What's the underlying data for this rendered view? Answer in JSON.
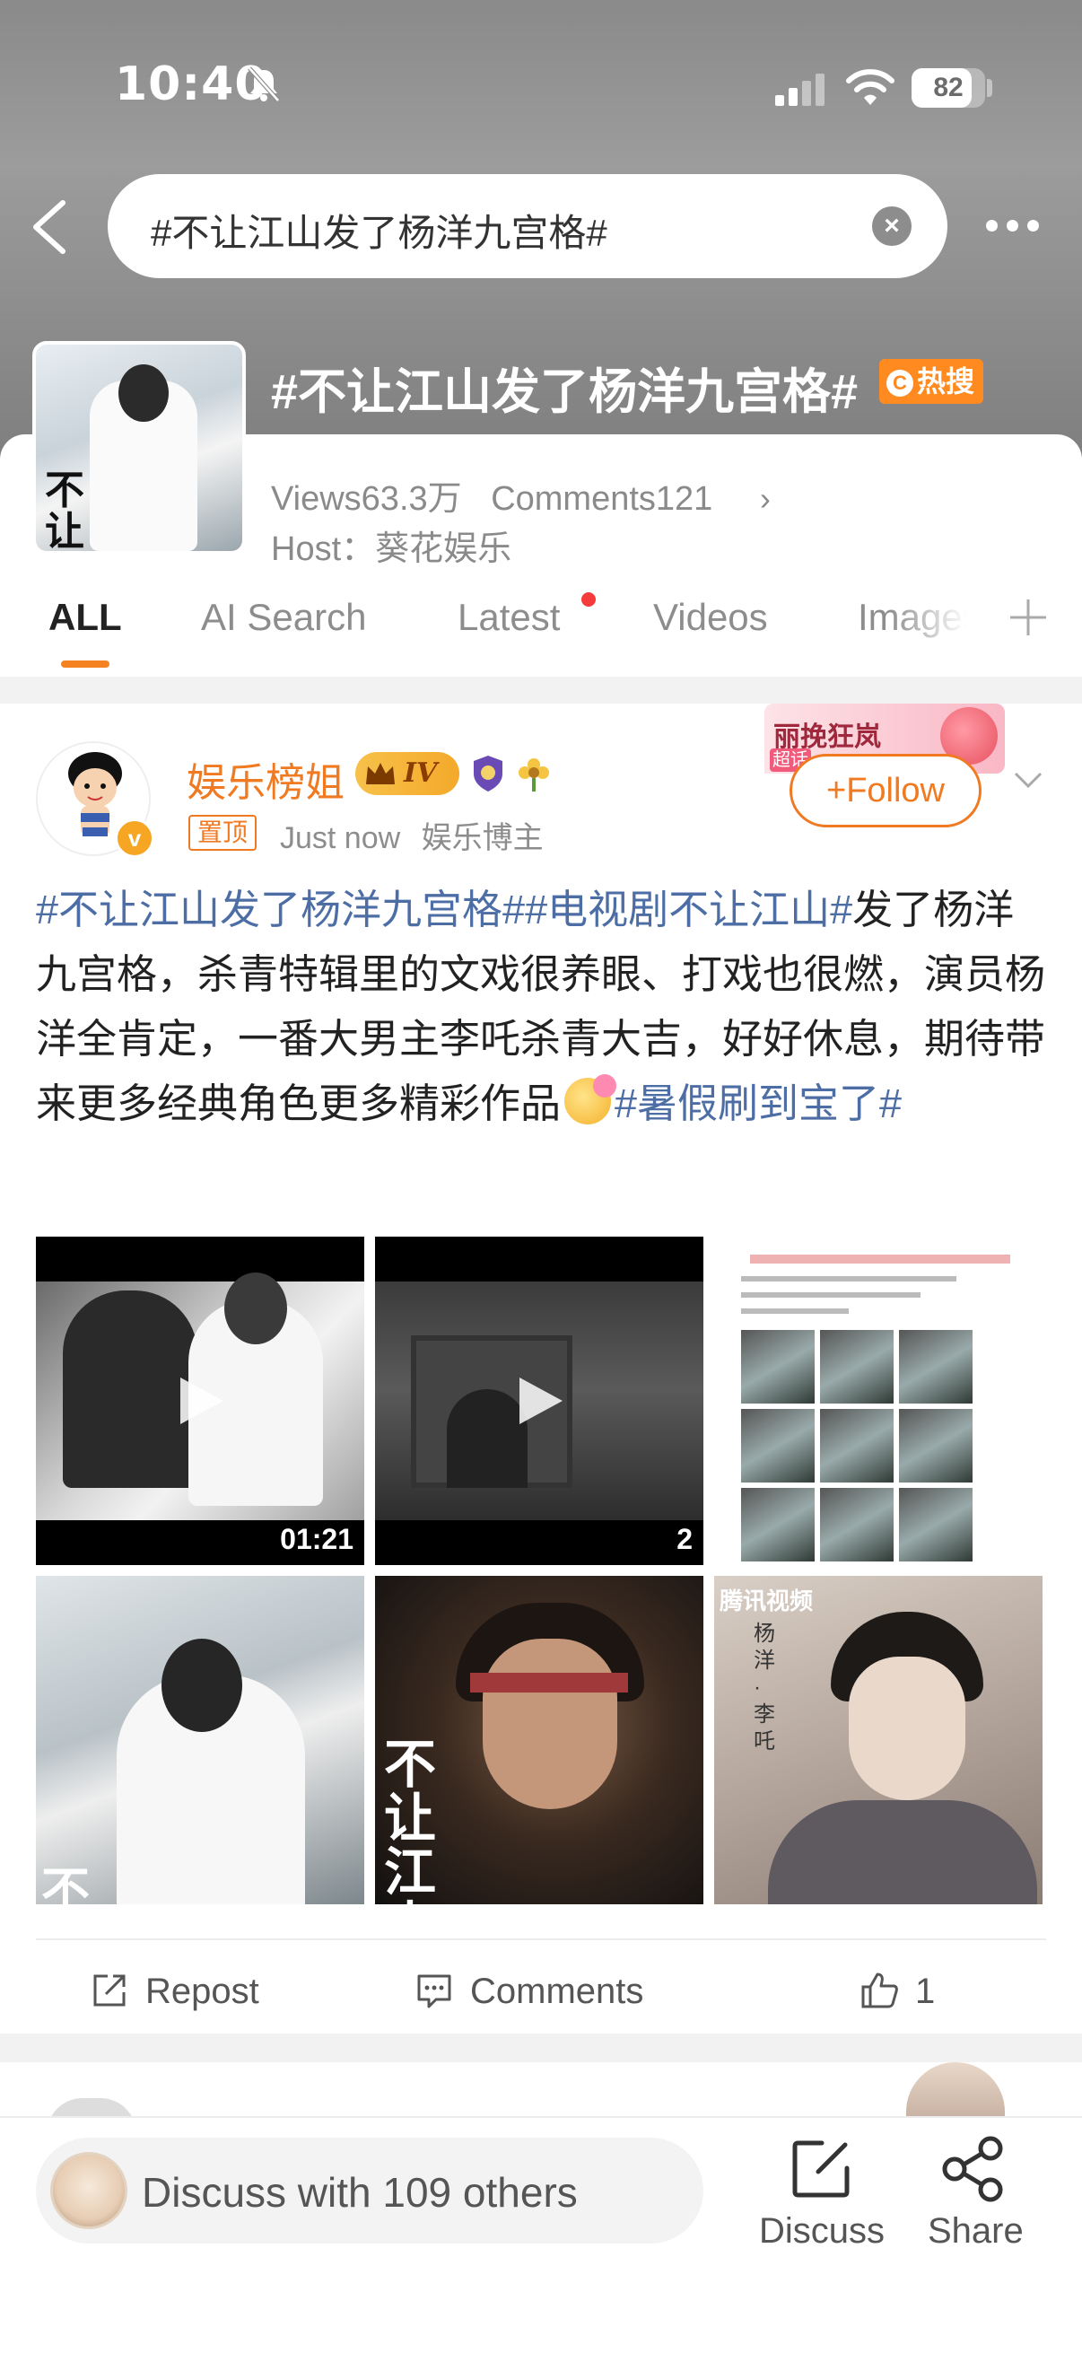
{
  "status_bar": {
    "time": "10:40",
    "battery": "82",
    "battery_level": 0.82
  },
  "search": {
    "query": "#不让江山发了杨洋九宫格#"
  },
  "topic": {
    "title": "#不让江山发了杨洋九宫格#",
    "hot_label": "热搜",
    "views": "Views63.3万",
    "comments": "Comments121",
    "host": "Host：葵花娱乐",
    "thumb_caption": "不让江山"
  },
  "tabs": [
    {
      "label": "ALL"
    },
    {
      "label": "AI Search"
    },
    {
      "label": "Latest"
    },
    {
      "label": "Videos"
    },
    {
      "label": "Images"
    }
  ],
  "post": {
    "author": "娱乐榜姐",
    "vip_level": "IV",
    "pinned": "置顶",
    "time": "Just now",
    "author_type": "娱乐博主",
    "follow_label": "+Follow",
    "promo_text": "丽挽狂岚",
    "promo_sub": "超话",
    "text_parts": [
      {
        "tag": "#不让江山发了杨洋九宫格#"
      },
      {
        "tag": "#电视剧不让江山#"
      },
      {
        "text": "发了杨洋九宫格，杀青特辑里的文戏很养眼、打戏也很燃，演员杨洋全肯定，一番大男主李吒杀青大吉，好好休息，期待带来更多经典角色更多精彩作品"
      },
      {
        "tag": "#暑假刷到宝了#"
      }
    ],
    "media": {
      "video1_duration": "01:21",
      "video2_duration": "2",
      "img4_caption": "不",
      "img5_caption": "不让江山",
      "img6_watermark": "腾讯视频",
      "img6_side": "杨洋·李吒"
    },
    "actions": {
      "repost": "Repost",
      "comments": "Comments",
      "likes": "1"
    }
  },
  "bottom_bar": {
    "discuss_prompt": "Discuss with 109 others",
    "discuss_label": "Discuss",
    "share_label": "Share"
  },
  "colors": {
    "accent": "#f07a21",
    "hashtag": "#4d6ea5",
    "hot": "#ff8a1f"
  }
}
